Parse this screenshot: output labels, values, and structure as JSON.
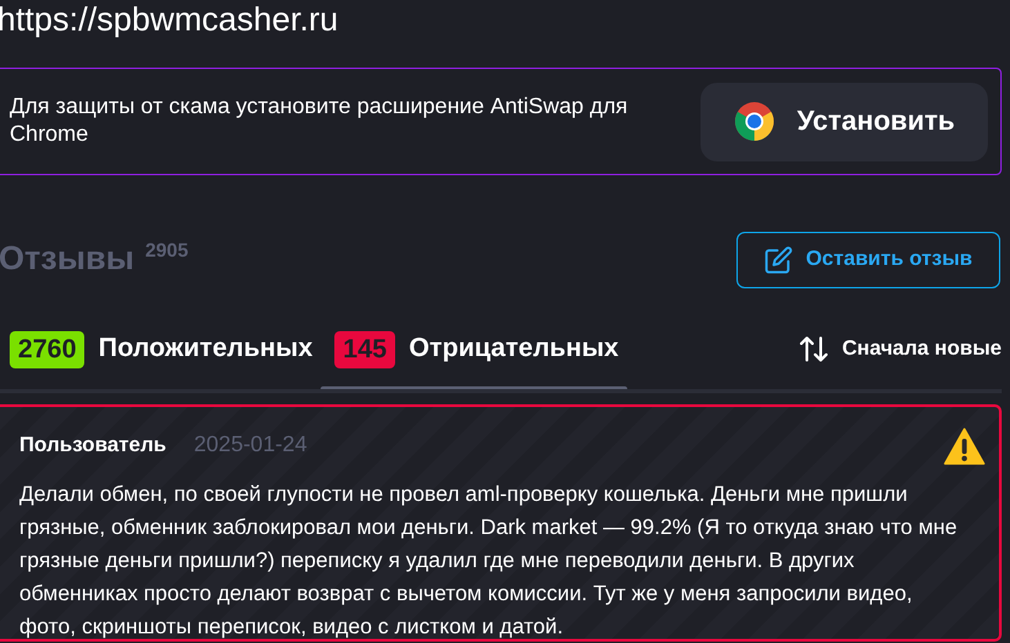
{
  "url": "https://spbwmcasher.ru",
  "banner": {
    "text": "Для защиты от скама установите расширение AntiSwap для Chrome",
    "button": "Установить"
  },
  "reviews_header": {
    "title": "Отзывы",
    "count": "2905",
    "button": "Оставить отзыв"
  },
  "tabs": [
    {
      "count": "2760",
      "label": "Положительных",
      "color": "#7ae000",
      "selected": false
    },
    {
      "count": "145",
      "label": "Отрицательных",
      "color": "#e8083e",
      "selected": true
    }
  ],
  "sort": {
    "label": "Сначала новые"
  },
  "reviews": [
    {
      "author": "Пользователь",
      "date": "2025-01-24",
      "kind": "negative",
      "text": "Делали обмен, по своей глупости не провел aml-проверку кошелька. Деньги мне пришли грязные, обменник заблокировал мои деньги. Dark market — 99.2% (Я то откуда знаю что мне грязные деньги пришли?) переписку я удалил где мне переводили деньги. В других обменниках просто делают возврат с вычетом комиссии. Тут же у меня запросили видео, фото, скриншоты переписок, видео с листком и датой."
    }
  ]
}
